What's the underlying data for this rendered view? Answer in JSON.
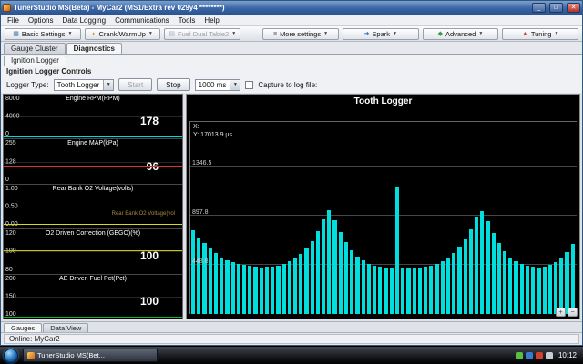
{
  "window": {
    "title": "TunerStudio MS(Beta) - MyCar2 (MS1/Extra rev 029y4 ********)",
    "minimize_glyph": "_",
    "maximize_glyph": "□",
    "close_glyph": "✕"
  },
  "menu": {
    "items": [
      "File",
      "Options",
      "Data Logging",
      "Communications",
      "Tools",
      "Help"
    ]
  },
  "toolbar": {
    "chevron": "▼",
    "buttons": [
      {
        "label": "Basic Settings",
        "icon": "basic-settings-icon",
        "glyph": "▦",
        "color": "#4a7ab5",
        "disabled": false
      },
      {
        "label": "Crank/WarmUp",
        "icon": "crank-warmup-icon",
        "glyph": "◐",
        "color": "#d09020",
        "disabled": false
      },
      {
        "label": "Fuel Dual Table2",
        "icon": "fuel-table-icon",
        "glyph": "▤",
        "color": "#9aa4b5",
        "disabled": true
      },
      {
        "label": "More settings",
        "icon": "more-settings-icon",
        "glyph": "≡",
        "color": "#555566",
        "disabled": false
      },
      {
        "label": "Spark",
        "icon": "spark-icon",
        "glyph": "➜",
        "color": "#2a6ac5",
        "disabled": false
      },
      {
        "label": "Advanced",
        "icon": "advanced-icon",
        "glyph": "◆",
        "color": "#3a9a50",
        "disabled": false
      },
      {
        "label": "Tuning",
        "icon": "tuning-icon",
        "glyph": "▲",
        "color": "#c04030",
        "disabled": false
      }
    ]
  },
  "tabs": [
    {
      "label": "Gauge Cluster",
      "active": false
    },
    {
      "label": "Diagnostics",
      "active": true
    }
  ],
  "subtab": {
    "label": "Ignition Logger"
  },
  "controls": {
    "title": "Ignition Logger Controls",
    "logger_type_label": "Logger Type:",
    "logger_type_value": "Tooth Logger",
    "start_label": "Start",
    "stop_label": "Stop",
    "interval_value": "1000 ms",
    "capture_label": "Capture to log file:"
  },
  "gauges": [
    {
      "title": "Engine RPM(RPM)",
      "value": "178",
      "max": "8000",
      "mid": "4000",
      "min": "0",
      "color": "#00dcdc",
      "trace_pct": 3
    },
    {
      "title": "Engine MAP(kPa)",
      "value": "96",
      "max": "255",
      "mid": "128",
      "min": "0",
      "color": "#e03030",
      "trace_pct": 38
    },
    {
      "title": "Rear Bank O2 Voltage(volts)",
      "value": "",
      "sub": "Rear Bank O2 Voltage(vol",
      "max": "1.00",
      "mid": "0.50",
      "min": "0.00",
      "color": "#d8d820",
      "trace_pct": 8
    },
    {
      "title": "O2 Driven Correction (GEGO)(%)",
      "value": "100",
      "max": "120",
      "mid": "100",
      "min": "80",
      "color": "#c8c800",
      "trace_pct": 50
    },
    {
      "title": "AE Driven Fuel Pct(Pct)",
      "value": "100",
      "max": "200",
      "mid": "150",
      "min": "100",
      "color": "#00c020",
      "trace_pct": 3
    }
  ],
  "bottom_tabs": [
    {
      "label": "Gauges",
      "active": true
    },
    {
      "label": "Data View",
      "active": false
    }
  ],
  "status": {
    "text": "Online: MyCar2"
  },
  "taskbar": {
    "task_label": "TunerStudio MS(Bet...",
    "time": "10:12",
    "tray_icons": [
      {
        "name": "tray-status-green-icon",
        "color": "#58c040"
      },
      {
        "name": "tray-network-icon",
        "color": "#3a7ad0"
      },
      {
        "name": "tray-alert-icon",
        "color": "#d04030"
      },
      {
        "name": "tray-volume-icon",
        "color": "#c8ccd4"
      }
    ]
  },
  "chart_data": {
    "type": "bar",
    "title": "Tooth Logger",
    "xlabel": "",
    "ylabel": "",
    "yticks": [
      448.8,
      897.8,
      1346.5
    ],
    "ylim": [
      0,
      1750
    ],
    "grid": true,
    "bar_color": "#00dede",
    "cursor": {
      "x": "X:",
      "y": "Y: 17013.9 µs"
    },
    "zoom_in_glyph": "+",
    "zoom_out_glyph": "−",
    "values": [
      760,
      700,
      645,
      595,
      552,
      518,
      490,
      470,
      455,
      444,
      436,
      430,
      427,
      429,
      434,
      443,
      457,
      478,
      508,
      548,
      598,
      665,
      755,
      865,
      945,
      858,
      748,
      652,
      578,
      524,
      486,
      459,
      441,
      430,
      424,
      421,
      1150,
      419,
      417,
      420,
      426,
      433,
      443,
      459,
      481,
      513,
      556,
      612,
      682,
      772,
      878,
      938,
      848,
      738,
      643,
      570,
      518,
      480,
      454,
      438,
      428,
      426,
      432,
      446,
      470,
      512,
      568,
      642
    ]
  }
}
